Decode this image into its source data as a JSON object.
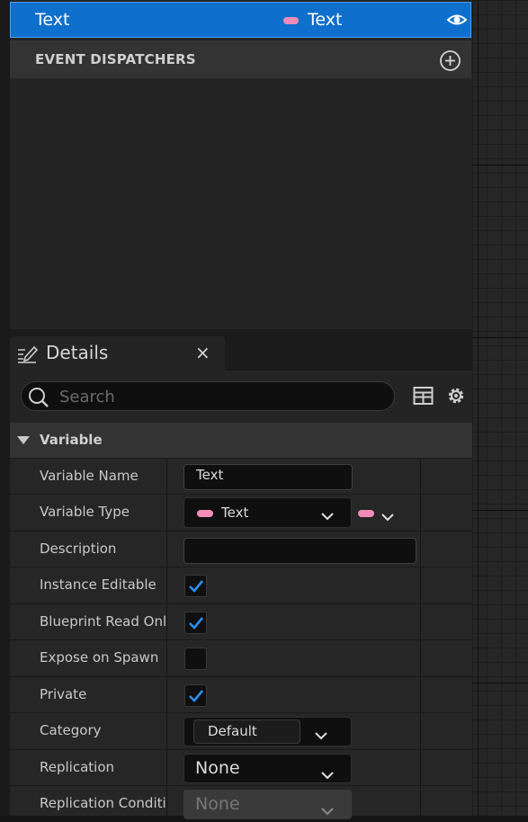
{
  "variable_row": {
    "name": "Text",
    "type": "Text"
  },
  "event_dispatchers": {
    "label": "EVENT DISPATCHERS"
  },
  "details_tab": {
    "title": "Details",
    "close": "×"
  },
  "search": {
    "placeholder": "Search"
  },
  "variable_section": {
    "title": "Variable",
    "rows": {
      "variable_name": {
        "label": "Variable Name",
        "value": "Text"
      },
      "variable_type": {
        "label": "Variable Type",
        "value": "Text"
      },
      "description": {
        "label": "Description",
        "value": ""
      },
      "instance_editable": {
        "label": "Instance Editable",
        "checked": true
      },
      "blueprint_read_only": {
        "label": "Blueprint Read Only",
        "checked": true
      },
      "expose_on_spawn": {
        "label": "Expose on Spawn",
        "checked": false
      },
      "private": {
        "label": "Private",
        "checked": true
      },
      "category": {
        "label": "Category",
        "value": "Default"
      },
      "replication": {
        "label": "Replication",
        "value": "None"
      },
      "replication_condition": {
        "label": "Replication Conditio",
        "value": "None"
      }
    }
  },
  "colors": {
    "selection": "#0e6fcc",
    "text_pin": "#f08cb7",
    "check": "#2a8ff0",
    "panel": "#242424"
  },
  "icons": [
    "eye-icon",
    "add-circle-icon",
    "pencil-details-icon",
    "search-icon",
    "table-view-icon",
    "gear-icon",
    "chevron-down-icon",
    "checkmark-icon"
  ]
}
